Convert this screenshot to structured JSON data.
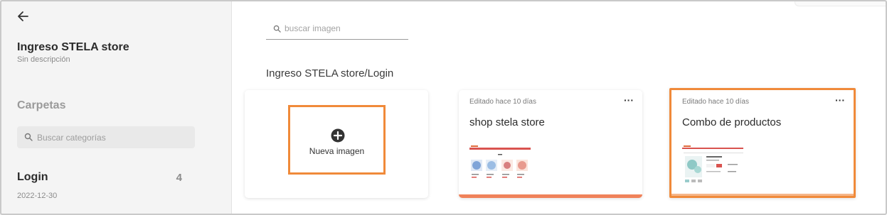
{
  "sidebar": {
    "project_title": "Ingreso STELA store",
    "project_description": "Sin descripción",
    "folders_title": "Carpetas",
    "category_search_placeholder": "Buscar categorías",
    "folders": [
      {
        "name": "Login",
        "count": "4",
        "date": "2022-12-30"
      }
    ]
  },
  "main": {
    "search_placeholder": "buscar imagen",
    "breadcrumb": "Ingreso STELA store/Login",
    "new_image_label": "Nueva imagen",
    "images": [
      {
        "edited": "Editado hace 10 días",
        "title": "shop stela store",
        "more": "···"
      },
      {
        "edited": "Editado hace 10 días",
        "title": "Combo de productos",
        "more": "···"
      }
    ]
  },
  "colors": {
    "accent": "#f08a3a",
    "card_bar": "#f0825a",
    "sidebar_bg": "#f4f4f4"
  },
  "icons": [
    "arrow-left-icon",
    "search-icon",
    "plus-circle-icon",
    "more-icon"
  ]
}
